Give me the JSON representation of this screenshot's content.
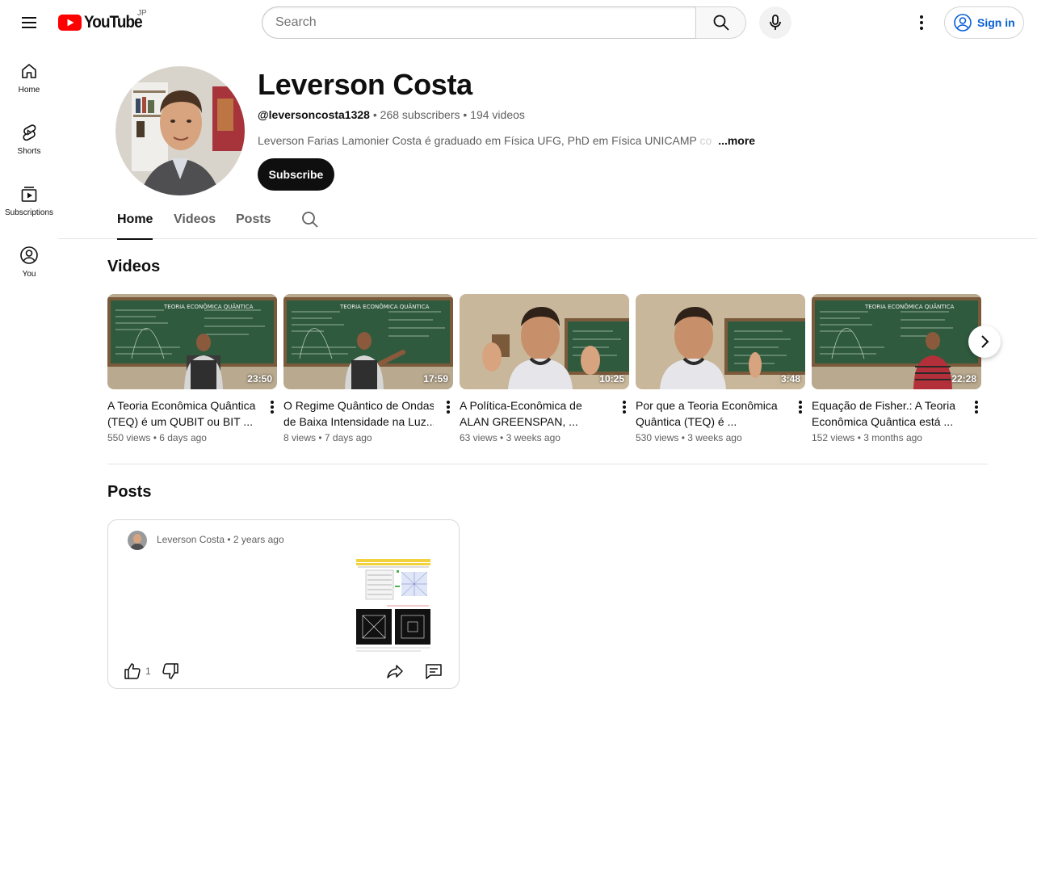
{
  "masthead": {
    "logo_text": "YouTube",
    "country_code": "JP",
    "search_placeholder": "Search",
    "signin_label": "Sign in"
  },
  "guide": {
    "items": [
      {
        "label": "Home",
        "icon": "home-icon"
      },
      {
        "label": "Shorts",
        "icon": "shorts-icon"
      },
      {
        "label": "Subscriptions",
        "icon": "subscriptions-icon"
      },
      {
        "label": "You",
        "icon": "you-icon"
      }
    ]
  },
  "channel": {
    "name": "Leverson Costa",
    "handle": "@leversoncosta1328",
    "subscribers": "268 subscribers",
    "videos_count": "194 videos",
    "description": "Leverson Farias Lamonier Costa é graduado em  Física UFG, PhD em Física UNICAMP",
    "description_fade": " co",
    "more_label": "...more",
    "subscribe_label": "Subscribe"
  },
  "tabs": [
    {
      "label": "Home",
      "active": true
    },
    {
      "label": "Videos",
      "active": false
    },
    {
      "label": "Posts",
      "active": false
    }
  ],
  "videos_section": {
    "title": "Videos",
    "videos": [
      {
        "title_line1": "A Teoria Econômica Quântica",
        "title_line2": "(TEQ) é um QUBIT ou BIT ...",
        "duration": "23:50",
        "views": "550 views",
        "age": "6 days ago"
      },
      {
        "title_line1": "O Regime Quântico de Ondas",
        "title_line2": "de Baixa Intensidade na Luz...",
        "duration": "17:59",
        "views": "8 views",
        "age": "7 days ago"
      },
      {
        "title_line1": "A Política-Econômica de",
        "title_line2": "ALAN GREENSPAN, ...",
        "duration": "10:25",
        "views": "63 views",
        "age": "3 weeks ago"
      },
      {
        "title_line1": "Por que a Teoria Econômica",
        "title_line2": "Quântica (TEQ) é ...",
        "duration": "3:48",
        "views": "530 views",
        "age": "3 weeks ago"
      },
      {
        "title_line1": "Equação de Fisher.: A Teoria",
        "title_line2": "Econômica Quântica está ...",
        "duration": "22:28",
        "views": "152 views",
        "age": "3 months ago"
      }
    ]
  },
  "posts_section": {
    "title": "Posts",
    "post": {
      "author": "Leverson Costa",
      "age": "2 years ago",
      "likes": "1"
    }
  },
  "colors": {
    "brand_red": "#ff0000",
    "link_blue": "#065fd4",
    "text_primary": "#0f0f0f",
    "text_secondary": "#606060",
    "chalkboard_green": "#2f5a3e"
  }
}
